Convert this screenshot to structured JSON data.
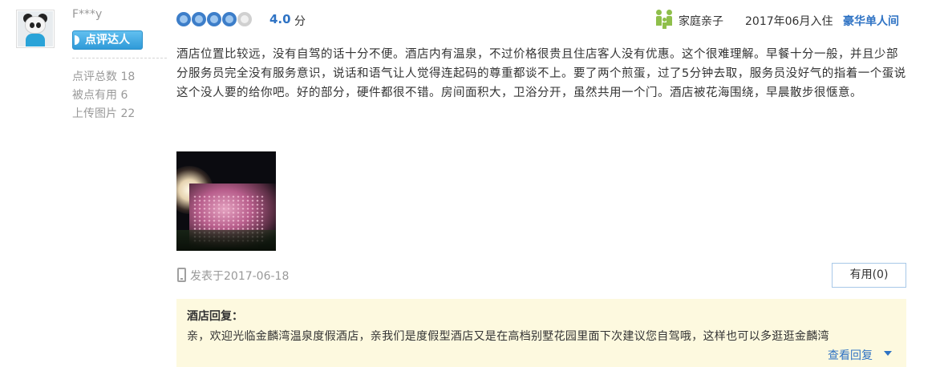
{
  "user": {
    "name": "F***y",
    "badge": "点评达人",
    "stats": [
      {
        "label": "点评总数",
        "value": "18"
      },
      {
        "label": "被点有用",
        "value": "6"
      },
      {
        "label": "上传图片",
        "value": "22"
      }
    ]
  },
  "review": {
    "rating_circles_filled": 4,
    "rating_circles_total": 5,
    "score": "4.0",
    "score_unit": "分",
    "trip_type": "家庭亲子",
    "checkin": "2017年06月入住",
    "room_type": "豪华单人间",
    "text": "酒店位置比较远，没有自驾的话十分不便。酒店内有温泉，不过价格很贵且住店客人没有优惠。这个很难理解。早餐十分一般，并且少部分服务员完全没有服务意识，说话和语气让人觉得连起码的尊重都谈不上。要了两个煎蛋，过了5分钟去取，服务员没好气的指着一个蛋说这个没人要的给你吧。好的部分，硬件都很不错。房间面积大，卫浴分开，虽然共用一个门。酒店被花海围绕，早晨散步很惬意。",
    "posted": "发表于2017-06-18",
    "useful_button": "有用(0)"
  },
  "reply": {
    "title": "酒店回复：",
    "text": "亲，欢迎光临金麟湾温泉度假酒店，亲我们是度假型酒店又是在高档别墅花园里面下次建议您自驾哦，这样也可以多逛逛金麟湾",
    "view_more": "查看回复"
  },
  "icons": {
    "rating": "rating-circle-icon",
    "trip_type": "family-icon",
    "device": "mobile-phone-icon",
    "expand": "caret-down-icon"
  },
  "colors": {
    "accent_blue": "#2f73c4",
    "badge_blue": "#3aa2e0",
    "reply_bg": "#fdf9df",
    "muted_text": "#999999"
  }
}
